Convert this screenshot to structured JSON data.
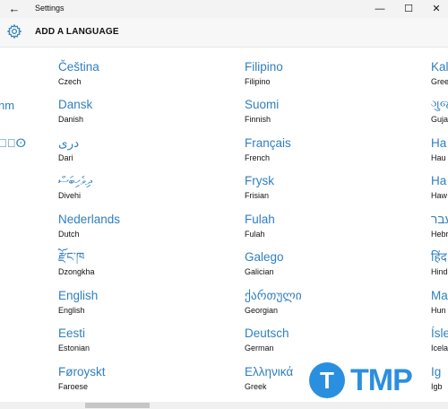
{
  "window": {
    "title": "Settings",
    "back_icon": "←",
    "minimize_icon": "—",
    "maximize_icon": "☐",
    "close_icon": "✕"
  },
  "header": {
    "title": "ADD A LANGUAGE"
  },
  "columns": [
    [
      {
        "native": "Čeština",
        "english": "Czech"
      },
      {
        "native": "Dansk",
        "english": "Danish"
      },
      {
        "native": "دری",
        "english": "Dari"
      },
      {
        "native": "ދިވެހިބަސް",
        "english": "Divehi"
      },
      {
        "native": "Nederlands",
        "english": "Dutch"
      },
      {
        "native": "རྫོང་ཁ",
        "english": "Dzongkha"
      },
      {
        "native": "English",
        "english": "English"
      },
      {
        "native": "Eesti",
        "english": "Estonian"
      },
      {
        "native": "Føroyskt",
        "english": "Faroese"
      }
    ],
    [
      {
        "native": "Filipino",
        "english": "Filipino"
      },
      {
        "native": "Suomi",
        "english": "Finnish"
      },
      {
        "native": "Français",
        "english": "French"
      },
      {
        "native": "Frysk",
        "english": "Frisian"
      },
      {
        "native": "Fulah",
        "english": "Fulah"
      },
      {
        "native": "Galego",
        "english": "Galician"
      },
      {
        "native": "ქართული",
        "english": "Georgian"
      },
      {
        "native": "Deutsch",
        "english": "German"
      },
      {
        "native": "Ελληνικά",
        "english": "Greek"
      }
    ]
  ],
  "right_edge": [
    {
      "native": "Kal",
      "english": "Gree"
    },
    {
      "native": "ગુજ",
      "english": "Guja"
    },
    {
      "native": "Ha",
      "english": "Hau"
    },
    {
      "native": "Ha",
      "english": "Haw"
    },
    {
      "native": "עבר",
      "english": "Hebr"
    },
    {
      "native": "हिंद",
      "english": "Hind"
    },
    {
      "native": "Ma",
      "english": "Hun"
    },
    {
      "native": "Ísle",
      "english": "Icela"
    },
    {
      "native": "Ig",
      "english": "Igb"
    }
  ],
  "left_edge": [
    {
      "text": "hm"
    },
    {
      "text": "ⵜ⵿ⵙ"
    }
  ],
  "watermark": {
    "letter": "T",
    "text": "TMP"
  }
}
